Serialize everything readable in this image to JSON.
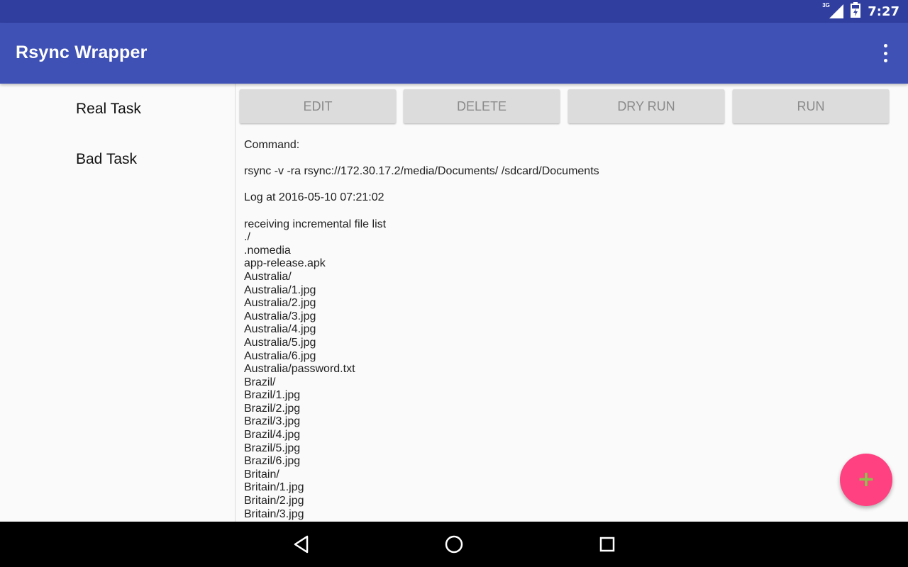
{
  "status_bar": {
    "network": "3G",
    "time": "7:27"
  },
  "app_bar": {
    "title": "Rsync Wrapper",
    "overflow_icon": "more-vert-icon"
  },
  "sidebar": {
    "tasks": [
      "Real Task",
      "Bad Task"
    ]
  },
  "actions": {
    "edit": "EDIT",
    "delete": "DELETE",
    "dry_run": "DRY RUN",
    "run": "RUN"
  },
  "detail": {
    "command_label": "Command:",
    "command": "rsync -v -ra rsync://172.30.17.2/media/Documents/ /sdcard/Documents",
    "log_header": "Log at 2016-05-10 07:21:02",
    "log_lines": [
      "receiving incremental file list",
      "./",
      ".nomedia",
      "app-release.apk",
      "Australia/",
      "Australia/1.jpg",
      "Australia/2.jpg",
      "Australia/3.jpg",
      "Australia/4.jpg",
      "Australia/5.jpg",
      "Australia/6.jpg",
      "Australia/password.txt",
      "Brazil/",
      "Brazil/1.jpg",
      "Brazil/2.jpg",
      "Brazil/3.jpg",
      "Brazil/4.jpg",
      "Brazil/5.jpg",
      "Brazil/6.jpg",
      "Britain/",
      "Britain/1.jpg",
      "Britain/2.jpg",
      "Britain/3.jpg"
    ]
  },
  "fab": {
    "icon": "plus-icon",
    "glyph": "+"
  },
  "nav_bar": {
    "back": "back-icon",
    "home": "home-icon",
    "recents": "recents-icon"
  },
  "colors": {
    "primary": "#3f51b5",
    "primary_dark": "#303f9f",
    "accent": "#ff4081",
    "fab_icon": "#8bc34a"
  }
}
